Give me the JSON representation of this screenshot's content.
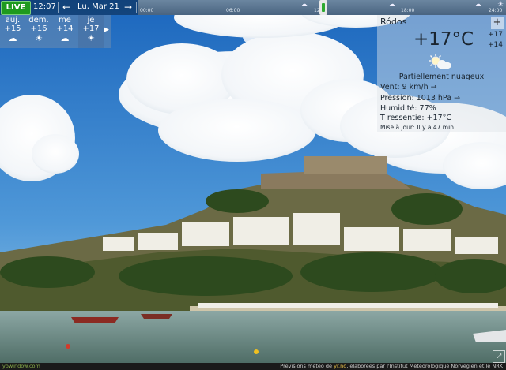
{
  "topbar": {
    "live_label": "LIVE",
    "time": "12:07",
    "date": "Lu, Mar 21",
    "ticks": [
      "00:00",
      "06:00",
      "12:00",
      "18:00",
      "24:00"
    ]
  },
  "days": [
    {
      "name": "auj.",
      "temp": "+15",
      "icon": "rain-cloud-icon"
    },
    {
      "name": "dem.",
      "temp": "+16",
      "icon": "sun-icon"
    },
    {
      "name": "me",
      "temp": "+14",
      "icon": "cloud-icon"
    },
    {
      "name": "je",
      "temp": "+17",
      "icon": "sun-icon"
    }
  ],
  "current": {
    "city": "Ródos",
    "temperature": "+17°C",
    "high": "+17",
    "low": "+14",
    "condition": "Partiellement nuageux",
    "wind_label": "Vent:",
    "wind_value": "9 km/h",
    "wind_arrow": "→",
    "pressure_label": "Pression:",
    "pressure_value": "1013 hPa",
    "pressure_arrow": "→",
    "humidity_label": "Humidité:",
    "humidity_value": "77%",
    "feels_label": "T ressentie:",
    "feels_value": "+17°C",
    "updated_label": "Mise à jour:",
    "updated_value": "Il y a 47 min"
  },
  "footer": {
    "brand": "yowindow.com",
    "credit_prefix": "Prévisions météo de",
    "credit_source": "yr.no",
    "credit_suffix": ", élaborées par l'Institut Météorologique Norvégien et le NRK"
  },
  "colors": {
    "sky_top": "#1f6fc4",
    "sky_bottom": "#8ec3ea",
    "sea": "#5f7e78",
    "live_green": "#1e9a1e"
  }
}
